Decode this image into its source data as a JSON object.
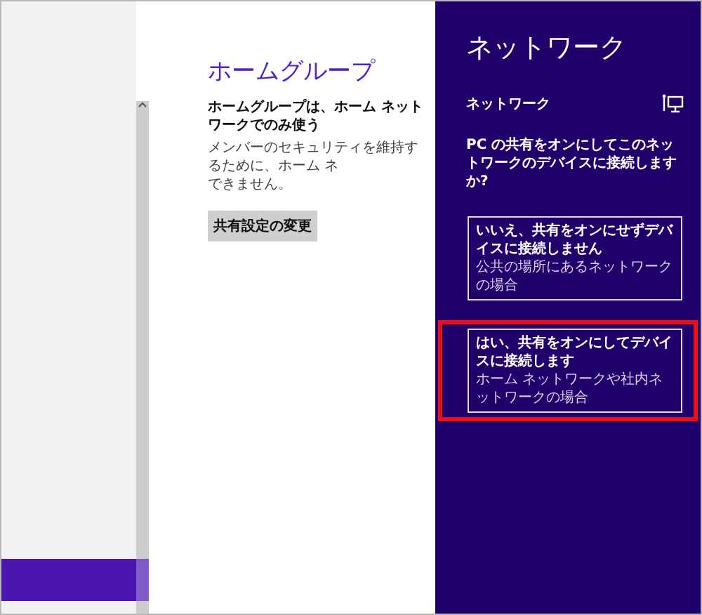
{
  "main": {
    "title": "ホームグループ",
    "heading": "ホームグループは、ホーム ネットワークでのみ使う",
    "description": [
      "メンバーのセキュリティを維持するために、ホーム ネ",
      "できません。"
    ],
    "button": "共有設定の変更"
  },
  "charm": {
    "title": "ネットワーク",
    "network_name": "ネットワーク",
    "question": "PC の共有をオンにしてこのネットワークのデバイスに接続しますか?",
    "options": [
      {
        "title": "いいえ、共有をオンにせずデバイスに接続しません",
        "description": "公共の場所にあるネットワークの場合",
        "selected": false
      },
      {
        "title": "はい、共有をオンにしてデバイスに接続します",
        "description": "ホーム ネットワークや社内ネットワークの場合",
        "selected": true
      }
    ]
  }
}
